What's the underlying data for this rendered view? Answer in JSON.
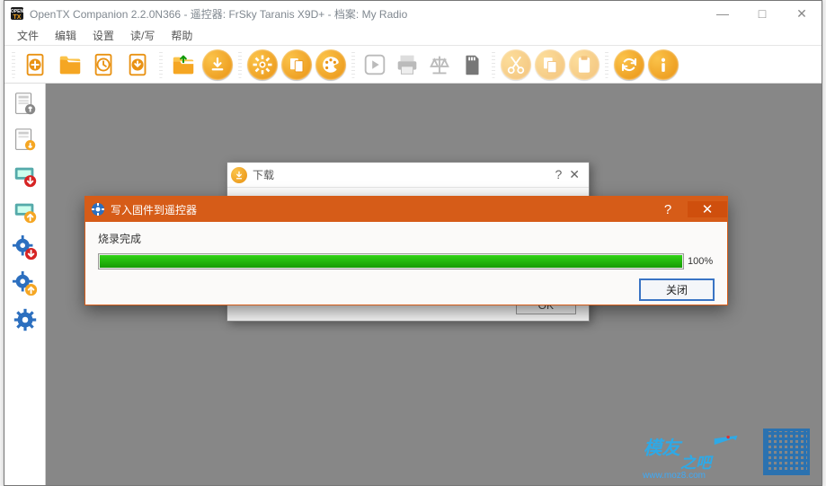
{
  "window": {
    "title": "OpenTX Companion 2.2.0N366 - 遥控器: FrSky Taranis X9D+ - 档案: My Radio",
    "controls": {
      "min": "—",
      "max": "□",
      "close": "✕"
    }
  },
  "menu": {
    "file": "文件",
    "edit": "编辑",
    "settings": "设置",
    "read_write": "读/写",
    "help": "帮助"
  },
  "toolbar_semantic": [
    "new-model",
    "open-folder",
    "recent",
    "save",
    "load-profile",
    "download",
    "settings-gear",
    "compare",
    "themes",
    "playback",
    "print",
    "balance",
    "sd-card",
    "cut",
    "copy",
    "paste",
    "sync",
    "about"
  ],
  "left_palette_semantic": [
    "page-preview",
    "page-preview-alt",
    "flash-down",
    "flash-device",
    "gear-down",
    "gear-up",
    "gear-config"
  ],
  "download_dialog": {
    "title": "下载",
    "help": "?",
    "close": "✕",
    "ok": "OK"
  },
  "flash_dialog": {
    "title": "写入固件到遥控器",
    "help": "?",
    "close": "✕",
    "status": "烧录完成",
    "progress_pct": "100%",
    "close_btn": "关闭"
  },
  "watermark": {
    "brand_a": "模友",
    "brand_b": "之吧",
    "url": "www.moz8.com"
  }
}
